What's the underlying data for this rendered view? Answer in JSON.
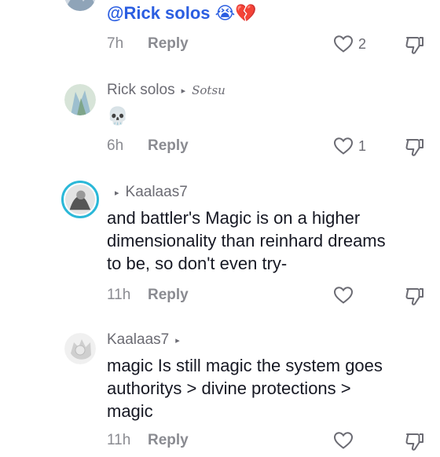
{
  "comments": [
    {
      "text": "@Rick solos 😭💔",
      "time": "7h",
      "reply_label": "Reply",
      "likes": "2"
    },
    {
      "username": "Rick solos",
      "reply_to": "Sotsu",
      "text": "💀",
      "time": "6h",
      "reply_label": "Reply",
      "likes": "1"
    },
    {
      "username": "Kaalaas7",
      "text_lines": [
        "and battler's Magic is on a higher",
        "dimensionality than reinhard dreams",
        "to be, so don't even try-"
      ],
      "time": "11h",
      "reply_label": "Reply",
      "likes": ""
    },
    {
      "username": "Kaalaas7",
      "text_lines": [
        "magic Is still magic the system goes",
        "authoritys > divine protections >",
        "magic"
      ],
      "time": "11h",
      "reply_label": "Reply"
    }
  ],
  "icons": {
    "arrow": "▸",
    "like": "heart-outline-icon",
    "dislike": "thumbs-down-icon"
  },
  "colors": {
    "mention": "#2b5ee1",
    "story_ring": "#2bb8d8"
  }
}
